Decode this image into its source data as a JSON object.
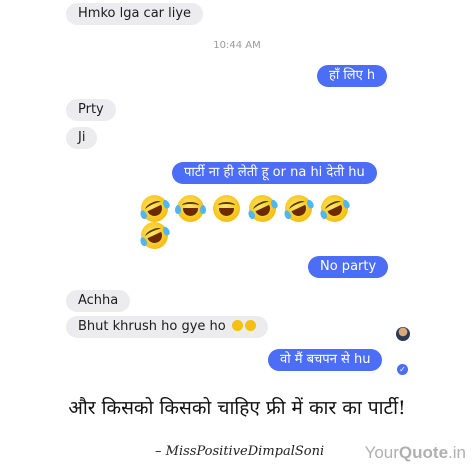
{
  "chat": {
    "timestamp": "10:44 AM",
    "messages": [
      {
        "side": "in",
        "text": "Hmko lga car liye"
      },
      {
        "side": "out",
        "text": "हाँ लिए h"
      },
      {
        "side": "in",
        "text": "Prty"
      },
      {
        "side": "in",
        "text": "Ji"
      },
      {
        "side": "out",
        "text": "पार्टी ना ही लेती हू or na hi देती hu"
      },
      {
        "side": "out",
        "text": "No party"
      },
      {
        "side": "in",
        "text": "Achha"
      },
      {
        "side": "in",
        "text": "Bhut khrush ho gye ho"
      },
      {
        "side": "out",
        "text": "वो मैं बचपन से hu"
      }
    ],
    "emoji_reaction_count": 7,
    "emoji_type": "laughing-with-tears"
  },
  "quote": {
    "text": "और किसको किसको चाहिए फ्री में कार का पार्टी!",
    "author": "– MissPositiveDimpalSoni"
  },
  "watermark": {
    "prefix": "Your",
    "brand": "Quote",
    "suffix": ".in"
  },
  "colors": {
    "outgoing": "#4c6ef7",
    "incoming": "#ececee"
  }
}
